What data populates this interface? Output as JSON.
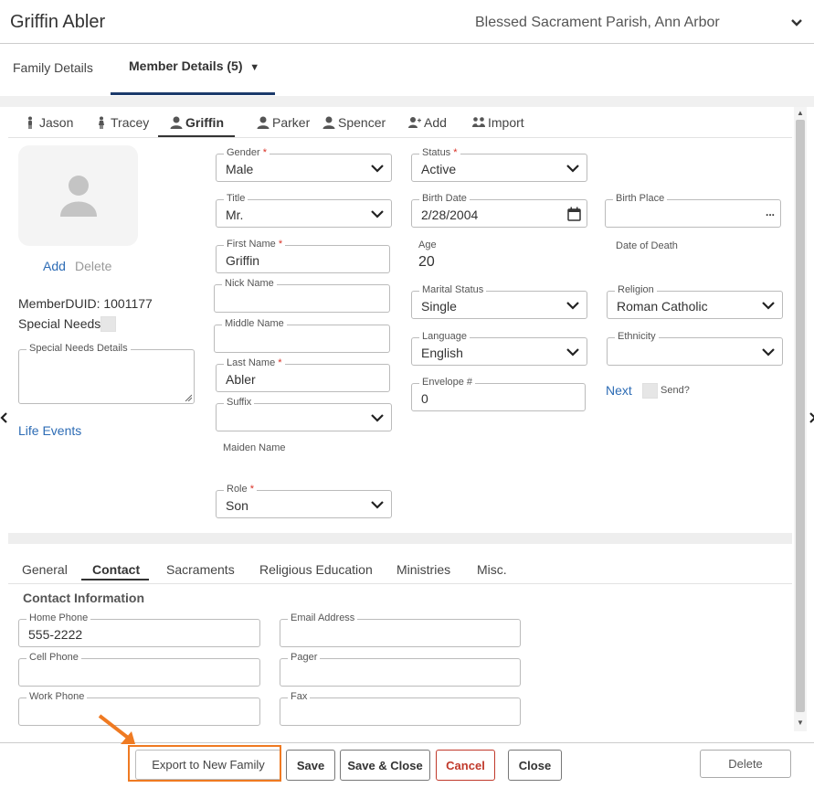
{
  "header": {
    "member_name": "Griffin Abler",
    "parish": "Blessed Sacrament Parish, Ann Arbor"
  },
  "top_tabs": [
    {
      "label": "Family Details"
    },
    {
      "label": "Member Details (5)"
    }
  ],
  "member_tabs": [
    {
      "label": "Jason",
      "icon": "person-male-icon"
    },
    {
      "label": "Tracey",
      "icon": "person-female-icon"
    },
    {
      "label": "Griffin",
      "icon": "person-icon",
      "active": true
    },
    {
      "label": "Parker",
      "icon": "person-icon"
    },
    {
      "label": "Spencer",
      "icon": "person-icon"
    },
    {
      "label": "Add",
      "icon": "add-person-icon"
    },
    {
      "label": "Import",
      "icon": "import-people-icon"
    }
  ],
  "photo": {
    "add_label": "Add",
    "delete_label": "Delete"
  },
  "left": {
    "member_duid": "MemberDUID: 1001177",
    "special_needs_label": "Special Needs",
    "special_needs_details_label": "Special Needs Details",
    "life_events_label": "Life Events"
  },
  "fields": {
    "gender": {
      "label": "Gender",
      "value": "Male",
      "required": "*"
    },
    "title": {
      "label": "Title",
      "value": "Mr."
    },
    "first_name": {
      "label": "First Name",
      "value": "Griffin",
      "required": "*"
    },
    "nick_name": {
      "label": "Nick Name",
      "value": ""
    },
    "middle_name": {
      "label": "Middle Name",
      "value": ""
    },
    "last_name": {
      "label": "Last Name",
      "value": "Abler",
      "required": "*"
    },
    "suffix": {
      "label": "Suffix",
      "value": ""
    },
    "maiden_name": {
      "label": "Maiden Name"
    },
    "role": {
      "label": "Role",
      "value": "Son",
      "required": "*"
    },
    "status": {
      "label": "Status",
      "value": "Active",
      "required": "*"
    },
    "birth_date": {
      "label": "Birth Date",
      "value": "2/28/2004"
    },
    "age": {
      "label": "Age",
      "value": "20"
    },
    "marital_status": {
      "label": "Marital Status",
      "value": "Single"
    },
    "language": {
      "label": "Language",
      "value": "English"
    },
    "envelope": {
      "label": "Envelope #",
      "value": "0"
    },
    "birth_place": {
      "label": "Birth Place",
      "value": "",
      "button": "..."
    },
    "date_of_death": {
      "label": "Date of Death"
    },
    "religion": {
      "label": "Religion",
      "value": "Roman Catholic"
    },
    "ethnicity": {
      "label": "Ethnicity",
      "value": ""
    },
    "next_label": "Next",
    "send_label": "Send?"
  },
  "bottom_tabs": [
    {
      "label": "General"
    },
    {
      "label": "Contact",
      "active": true
    },
    {
      "label": "Sacraments"
    },
    {
      "label": "Religious Education"
    },
    {
      "label": "Ministries"
    },
    {
      "label": "Misc."
    }
  ],
  "contact": {
    "section_title": "Contact Information",
    "home_phone": {
      "label": "Home Phone",
      "value": "555-2222"
    },
    "email": {
      "label": "Email Address",
      "value": ""
    },
    "cell_phone": {
      "label": "Cell Phone",
      "value": ""
    },
    "pager": {
      "label": "Pager",
      "value": ""
    },
    "work_phone": {
      "label": "Work Phone",
      "value": ""
    },
    "fax": {
      "label": "Fax",
      "value": ""
    }
  },
  "footer": {
    "export_label": "Export to New Family",
    "save_label": "Save",
    "save_close_label": "Save & Close",
    "cancel_label": "Cancel",
    "close_label": "Close",
    "delete_label": "Delete"
  },
  "colors": {
    "link": "#2d6cb5",
    "required": "#d93025",
    "highlight": "#ef7a22",
    "tab_underline": "#1b3a6b",
    "cancel": "#c0392b"
  }
}
